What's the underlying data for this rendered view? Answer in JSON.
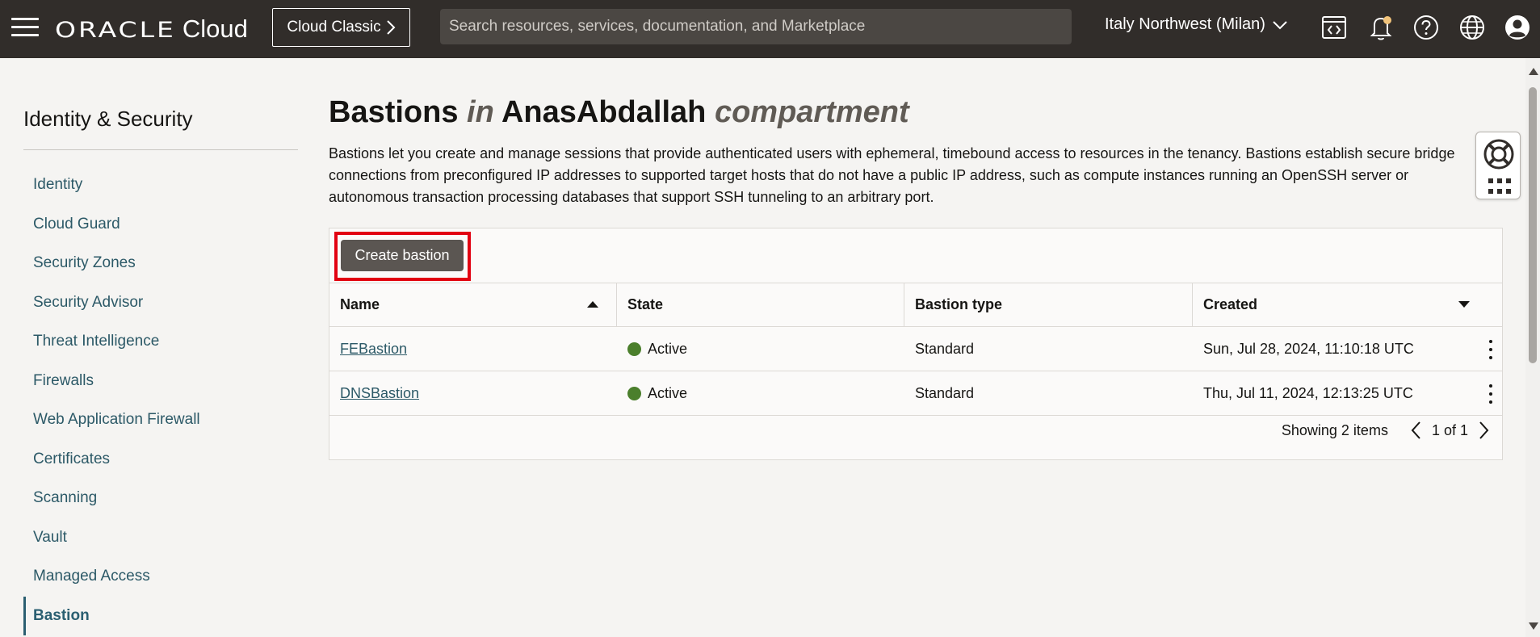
{
  "topbar": {
    "brand": "ORACLE",
    "product": "Cloud",
    "classic_button": "Cloud Classic",
    "search_placeholder": "Search resources, services, documentation, and Marketplace",
    "region": "Italy Northwest (Milan)"
  },
  "sidebar": {
    "title": "Identity & Security",
    "items": [
      {
        "label": "Identity"
      },
      {
        "label": "Cloud Guard"
      },
      {
        "label": "Security Zones"
      },
      {
        "label": "Security Advisor"
      },
      {
        "label": "Threat Intelligence"
      },
      {
        "label": "Firewalls"
      },
      {
        "label": "Web Application Firewall"
      },
      {
        "label": "Certificates"
      },
      {
        "label": "Scanning"
      },
      {
        "label": "Vault"
      },
      {
        "label": "Managed Access"
      },
      {
        "label": "Bastion",
        "active": true
      }
    ]
  },
  "main": {
    "title_resource": "Bastions",
    "title_in": "in",
    "title_compartment_name": "AnasAbdallah",
    "title_compartment_word": "compartment",
    "description": "Bastions let you create and manage sessions that provide authenticated users with ephemeral, timebound access to resources in the tenancy. Bastions establish secure bridge connections from preconfigured IP addresses to supported target hosts that do not have a public IP address, such as compute instances running an OpenSSH server or autonomous transaction processing databases that support SSH tunneling to an arbitrary port.",
    "create_button": "Create bastion",
    "table": {
      "columns": [
        "Name",
        "State",
        "Bastion type",
        "Created"
      ],
      "rows": [
        {
          "name": "FEBastion",
          "state": "Active",
          "type": "Standard",
          "created": "Sun, Jul 28, 2024, 11:10:18 UTC"
        },
        {
          "name": "DNSBastion",
          "state": "Active",
          "type": "Standard",
          "created": "Thu, Jul 11, 2024, 12:13:25 UTC"
        }
      ]
    },
    "pager": {
      "showing": "Showing 2 items",
      "page": "1 of 1"
    }
  },
  "colors": {
    "topbar": "#312d2a",
    "link": "#2c5967",
    "active_dot": "#4b7f2c",
    "highlight": "#e20011",
    "primary_button": "#5b5652"
  }
}
